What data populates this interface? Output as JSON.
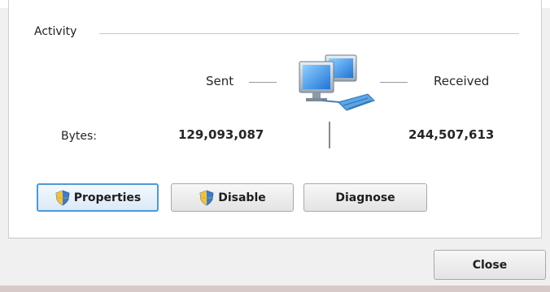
{
  "activity": {
    "legend": "Activity",
    "sent_label": "Sent",
    "received_label": "Received",
    "icon": "network-computers-icon",
    "bytes_label": "Bytes:",
    "bytes_sent": "129,093,087",
    "bytes_received": "244,507,613"
  },
  "buttons": {
    "properties": "Properties",
    "disable": "Disable",
    "diagnose": "Diagnose",
    "close": "Close",
    "shield_icon": "shield-icon"
  },
  "colors": {
    "focus_border": "#4a9ad8",
    "panel_bg": "#ffffff",
    "window_bg": "#f0f0f0"
  }
}
